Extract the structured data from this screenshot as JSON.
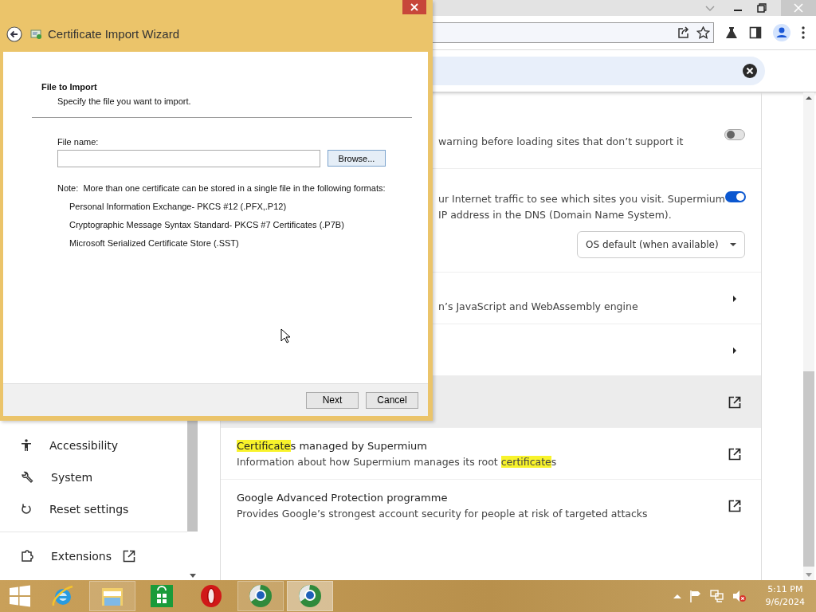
{
  "browser": {
    "sidebar": {
      "items": [
        {
          "label": "Accessibility",
          "external": false
        },
        {
          "label": "System",
          "external": false
        },
        {
          "label": "Reset settings",
          "external": false
        },
        {
          "label": "Extensions",
          "external": true
        }
      ]
    },
    "rows": [
      {
        "kind": "toggle",
        "lines": [
          "warning before loading sites that don’t support it"
        ],
        "on": false,
        "hovered": false
      },
      {
        "kind": "toggle",
        "lines": [
          "ur Internet traffic to see which sites you visit. Supermium",
          "IP address in the DNS (Domain Name System)."
        ],
        "on": true,
        "hovered": false,
        "select": "OS default (when available)"
      },
      {
        "kind": "submenu",
        "lines": [
          "n’s JavaScript and WebAssembly engine"
        ],
        "hovered": false
      },
      {
        "kind": "submenu",
        "lines": [],
        "hovered": false
      },
      {
        "kind": "external",
        "lines": [],
        "hovered": true
      },
      {
        "kind": "external",
        "title": [
          {
            "text": "Certificate",
            "highlight": true
          },
          {
            "text": "s managed by Supermium",
            "highlight": false
          }
        ],
        "description": [
          {
            "text": "Information about how Supermium manages its root ",
            "highlight": false
          },
          {
            "text": "certificate",
            "highlight": true
          },
          {
            "text": "s",
            "highlight": false
          }
        ],
        "hovered": false
      },
      {
        "kind": "external",
        "title": [
          {
            "text": "Google Advanced Protection programme",
            "highlight": false
          }
        ],
        "description": [
          {
            "text": "Provides Google’s strongest account security for people at risk of targeted attacks",
            "highlight": false
          }
        ],
        "hovered": false
      }
    ]
  },
  "wizard": {
    "title": "Certificate Import Wizard",
    "heading": "File to Import",
    "subheading": "Specify the file you want to import.",
    "file_label": "File name:",
    "browse": "Browse...",
    "note": "Note:  More than one certificate can be stored in a single file in the following formats:",
    "formats": [
      "Personal Information Exchange- PKCS #12 (.PFX,.P12)",
      "Cryptographic Message Syntax Standard- PKCS #7 Certificates (.P7B)",
      "Microsoft Serialized Certificate Store (.SST)"
    ],
    "buttons": [
      {
        "label": "Next"
      },
      {
        "label": "Cancel"
      }
    ]
  },
  "taskbar": {
    "apps": [
      {
        "open": false,
        "selected": false
      },
      {
        "open": true,
        "selected": false
      },
      {
        "open": false,
        "selected": false
      },
      {
        "open": false,
        "selected": false
      },
      {
        "open": true,
        "selected": false
      },
      {
        "open": true,
        "selected": true
      }
    ],
    "time": "5:11 PM",
    "date": "9/6/2024"
  }
}
